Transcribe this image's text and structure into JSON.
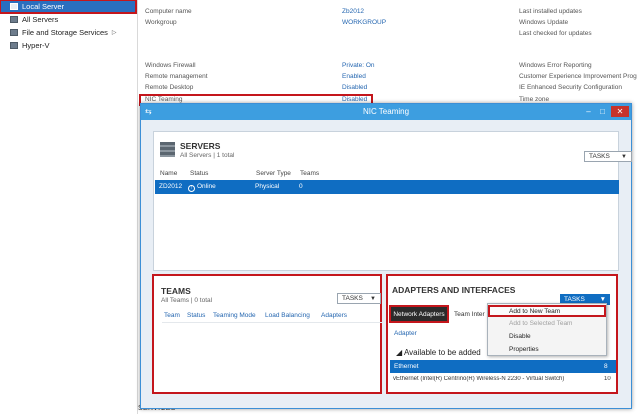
{
  "nav": {
    "items": [
      {
        "label": "Local Server",
        "icon": "server-icon",
        "selected": true
      },
      {
        "label": "All Servers",
        "icon": "servers-icon"
      },
      {
        "label": "File and Storage Services",
        "icon": "storage-icon",
        "chevron": "▷"
      },
      {
        "label": "Hyper-V",
        "icon": "hyperv-icon"
      }
    ]
  },
  "properties": {
    "rows_top": [
      {
        "key": "Computer name",
        "value": "Zb2012",
        "right": "Last installed updates"
      },
      {
        "key": "Workgroup",
        "value": "WORKGROUP",
        "right": "Windows Update"
      },
      {
        "key": "",
        "value": "",
        "right": "Last checked for updates"
      }
    ],
    "rows_bottom": [
      {
        "key": "Windows Firewall",
        "value": "Private: On",
        "right": "Windows Error Reporting"
      },
      {
        "key": "Remote management",
        "value": "Enabled",
        "right": "Customer Experience Improvement Prog"
      },
      {
        "key": "Remote Desktop",
        "value": "Disabled",
        "right": "IE Enhanced Security Configuration"
      },
      {
        "key": "NIC Teaming",
        "value": "Disabled",
        "right": "Time zone"
      }
    ]
  },
  "bottom_label": "SERVICES",
  "dialog": {
    "title": "NIC Teaming",
    "servers": {
      "title": "SERVERS",
      "subtitle": "All Servers | 1 total",
      "tasks": "TASKS",
      "columns": [
        "Name",
        "Status",
        "Server Type",
        "Teams"
      ],
      "row": {
        "name": "ZD2012",
        "status": "Online",
        "type": "Physical",
        "teams": "0"
      }
    },
    "teams": {
      "title": "TEAMS",
      "subtitle": "All Teams | 0 total",
      "tasks": "TASKS",
      "columns": [
        "Team",
        "Status",
        "Teaming Mode",
        "Load Balancing",
        "Adapters"
      ]
    },
    "adapters": {
      "title": "ADAPTERS AND INTERFACES",
      "tasks": "TASKS",
      "tab_active": "Network Adapters",
      "tab_other": "Team Inter",
      "column": "Adapter",
      "group": "Available to be added",
      "selected_row": "Ethernet",
      "selected_row_end": "8",
      "other_row": "vEthernet (Intel(R) Centrino(R) Wireless-N 2230 - Virtual Switch)",
      "other_row_end": "10"
    }
  },
  "context_menu": [
    {
      "label": "Add to New Team",
      "enabled": true,
      "highlighted": true
    },
    {
      "label": "Add to Selected Team",
      "enabled": false
    },
    {
      "label": "Disable",
      "enabled": true
    },
    {
      "label": "Properties",
      "enabled": true
    }
  ],
  "colors": {
    "selection": "#0f6dc2",
    "titlebar": "#3d9ee0",
    "annotation": "#c4161c",
    "link": "#2466b0"
  }
}
